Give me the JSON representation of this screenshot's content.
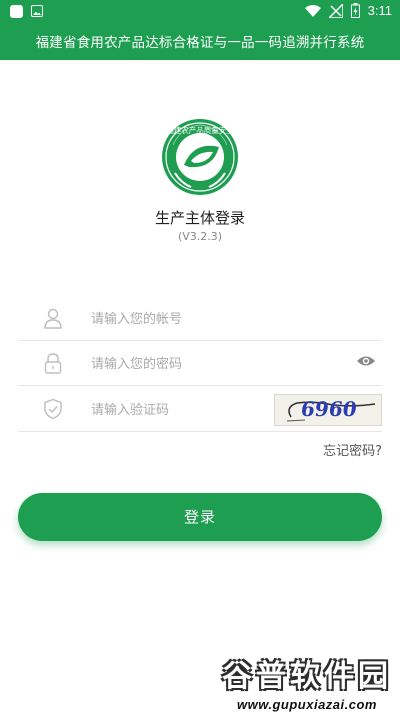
{
  "status_bar": {
    "time": "3:11"
  },
  "header": {
    "title": "福建省食用农产品达标合格证与一品一码追溯并行系统"
  },
  "logo": {
    "text": "福建农产品质量安全",
    "icon": "leaf-logo-icon"
  },
  "login": {
    "title": "生产主体登录",
    "version": "(V3.2.3)"
  },
  "form": {
    "account_placeholder": "请输入您的帐号",
    "password_placeholder": "请输入您的密码",
    "captcha_placeholder": "请输入验证码",
    "captcha_code": "6960",
    "forgot_password": "忘记密码?",
    "submit_label": "登录"
  },
  "watermark": {
    "title": "谷普软件园",
    "url": "www.gupuxiazai.com"
  },
  "colors": {
    "primary": "#1e9e50",
    "placeholder": "#aaaaaa",
    "divider": "#e6e6e6"
  }
}
